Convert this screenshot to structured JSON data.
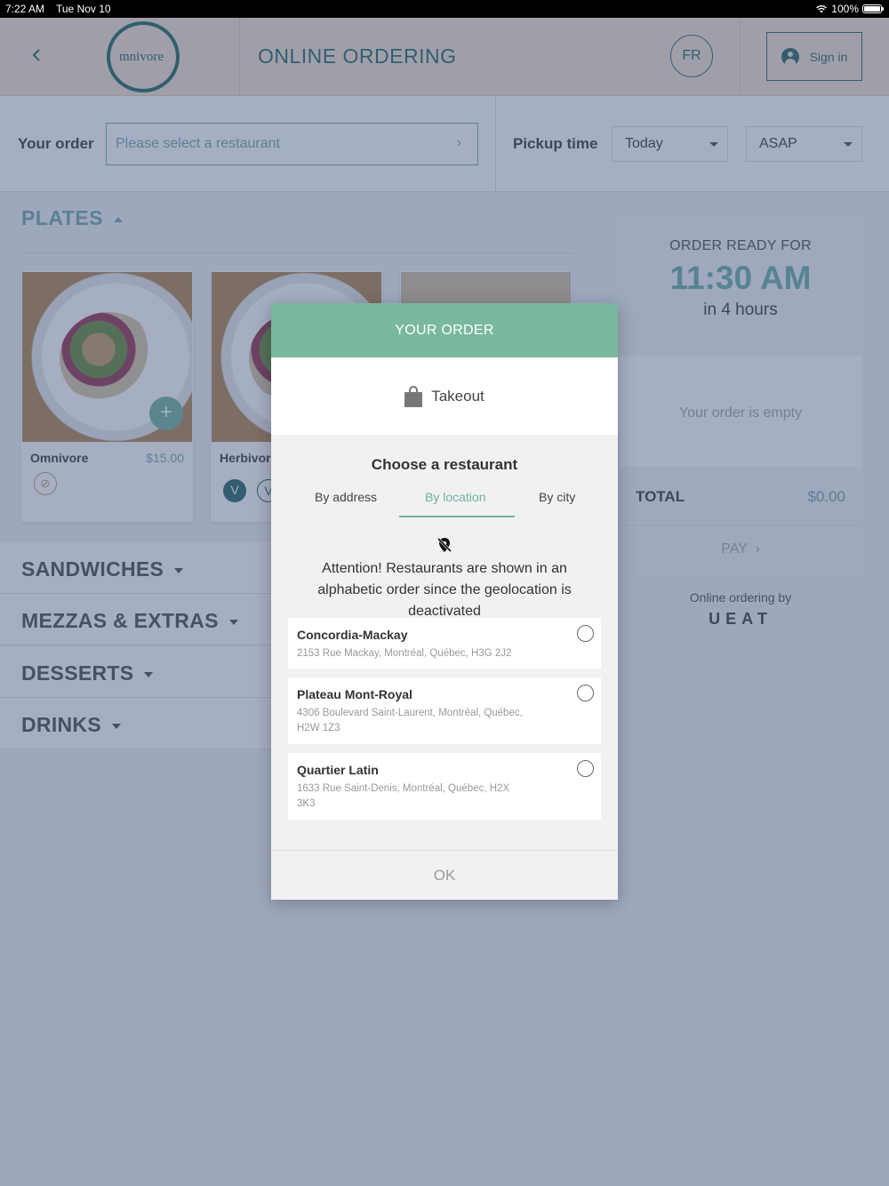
{
  "status_bar": {
    "time": "7:22 AM",
    "date": "Tue Nov 10",
    "battery": "100%"
  },
  "header": {
    "logo_text": "mnivore",
    "title": "ONLINE ORDERING",
    "lang_button": "FR",
    "signin_label": "Sign in"
  },
  "order_bar": {
    "your_order_label": "Your order",
    "restaurant_placeholder": "Please select a restaurant",
    "pickup_label": "Pickup time",
    "day_value": "Today",
    "time_value": "ASAP"
  },
  "menu": {
    "plates_label": "PLATES",
    "cards": [
      {
        "name": "Omnivore",
        "price": "$15.00"
      },
      {
        "name": "Herbivore",
        "price": ""
      },
      {
        "name": "",
        "price": ""
      }
    ],
    "categories": [
      "SANDWICHES",
      "MEZZAS & EXTRAS",
      "DESSERTS",
      "DRINKS"
    ]
  },
  "summary": {
    "ready_for": "ORDER READY FOR",
    "ready_time": "11:30 AM",
    "ready_in": "in 4 hours",
    "empty_text": "Your order is empty",
    "total_label": "TOTAL",
    "total_value": "$0.00",
    "pay_label": "PAY",
    "powered_by": "Online ordering by",
    "brand": "UEAT"
  },
  "modal": {
    "title": "YOUR ORDER",
    "mode": "Takeout",
    "choose_label": "Choose a restaurant",
    "tabs": [
      "By address",
      "By location",
      "By city"
    ],
    "active_tab": "By location",
    "attention": "Attention! Restaurants are shown in an alphabetic order since the geolocation is deactivated",
    "restaurants": [
      {
        "name": "Concordia-Mackay",
        "address": "2153 Rue Mackay, Montréal, Québec, H3G 2J2"
      },
      {
        "name": "Plateau Mont-Royal",
        "address": "4306 Boulevard Saint-Laurent, Montréal, Québec, H2W 1Z3"
      },
      {
        "name": "Quartier Latin",
        "address": "1633 Rue Saint-Denis, Montréal, Québec, H2X 3K3"
      }
    ],
    "ok_label": "OK"
  },
  "colors": {
    "accent": "#6fb3a6",
    "header_bg": "#f6e4d2",
    "brand_dark": "#2f6e68",
    "modal_header": "#78b89e"
  }
}
